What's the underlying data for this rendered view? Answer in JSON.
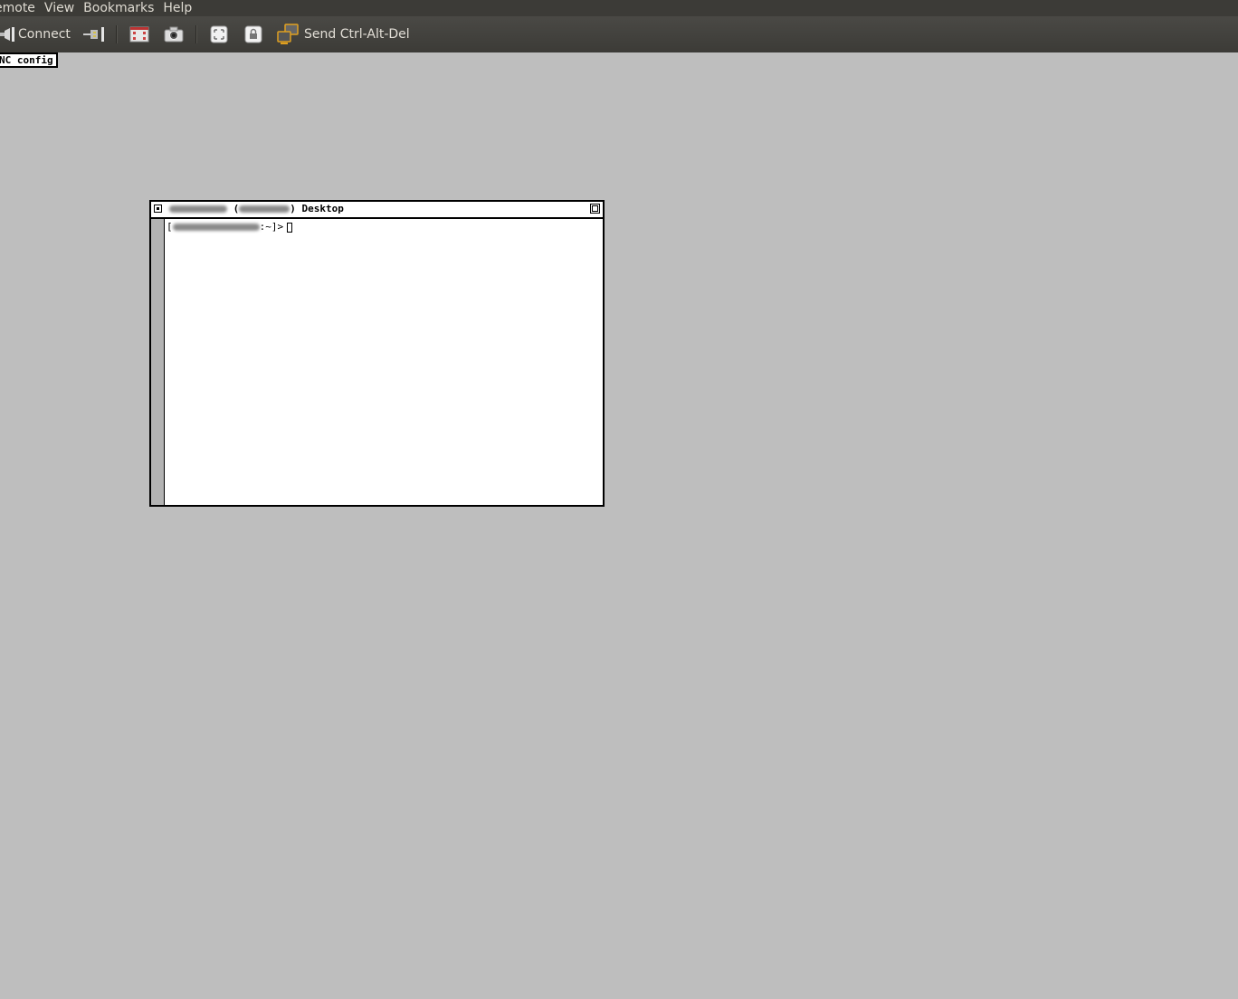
{
  "menubar": {
    "items": [
      "emote",
      "View",
      "Bookmarks",
      "Help"
    ]
  },
  "toolbar": {
    "connect_label": "Connect",
    "send_cad_label": "Send Ctrl-Alt-Del",
    "icons": [
      "connect-plug-icon",
      "disconnect-plug-icon",
      "fullscreen-icon",
      "screenshot-camera-icon",
      "scale-icon",
      "lock-keyboard-icon",
      "send-keys-icon"
    ]
  },
  "vnc_config_label": "NC config",
  "xterm": {
    "title_suffix": ") Desktop",
    "title_paren_open": "(",
    "prompt_suffix": ":~]>",
    "prompt_prefix": "["
  }
}
